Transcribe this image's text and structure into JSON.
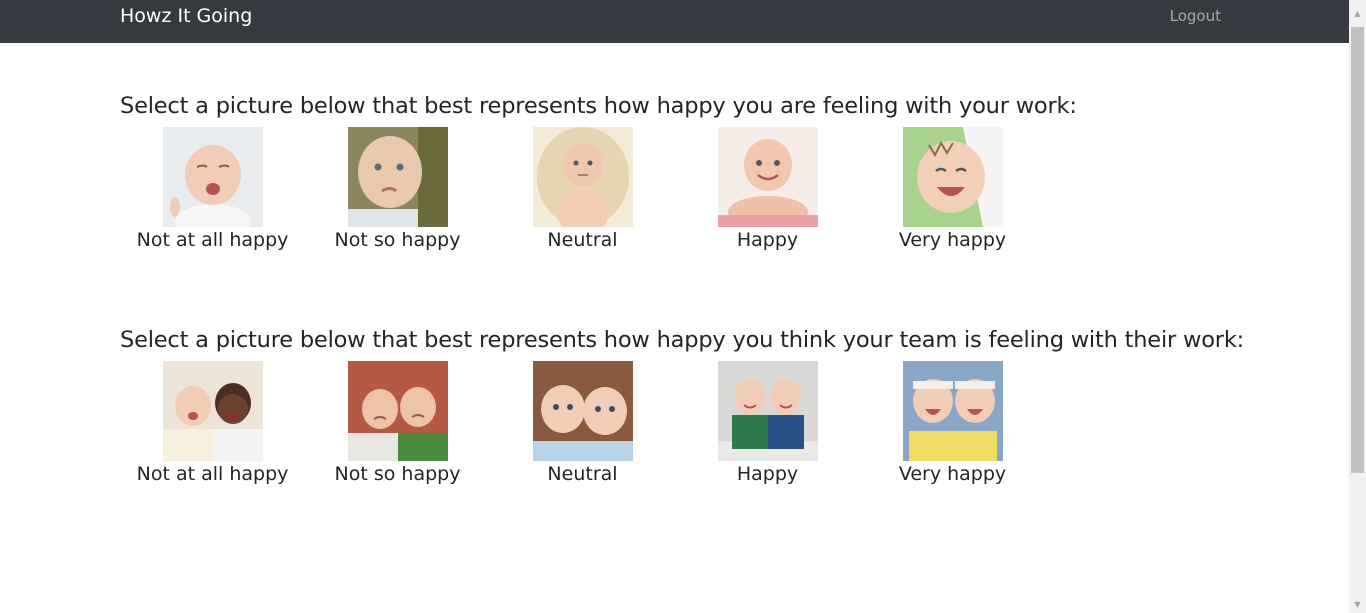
{
  "navbar": {
    "brand": "Howz It Going",
    "logout": "Logout"
  },
  "sections": [
    {
      "question": "Select a picture below that best represents how happy you are feeling with your work:",
      "options": [
        {
          "label": "Not at all happy",
          "image": "crying-baby-photo"
        },
        {
          "label": "Not so happy",
          "image": "pouting-baby-photo"
        },
        {
          "label": "Neutral",
          "image": "neutral-baby-photo"
        },
        {
          "label": "Happy",
          "image": "smiling-baby-photo"
        },
        {
          "label": "Very happy",
          "image": "laughing-baby-photo"
        }
      ]
    },
    {
      "question": "Select a picture below that best represents how happy you think your team is feeling with their work:",
      "options": [
        {
          "label": "Not at all happy",
          "image": "crying-twins-photo"
        },
        {
          "label": "Not so happy",
          "image": "frowning-twins-photo"
        },
        {
          "label": "Neutral",
          "image": "neutral-twins-photo"
        },
        {
          "label": "Happy",
          "image": "smiling-twins-photo"
        },
        {
          "label": "Very happy",
          "image": "laughing-twins-photo"
        }
      ]
    }
  ]
}
